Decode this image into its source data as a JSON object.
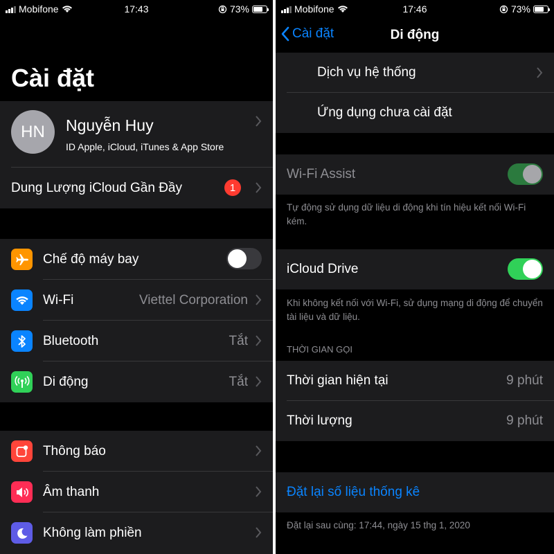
{
  "left": {
    "status": {
      "carrier": "Mobifone",
      "time": "17:43",
      "battery": "73%"
    },
    "title": "Cài đặt",
    "profile": {
      "initials": "HN",
      "name": "Nguyễn Huy",
      "subtitle": "ID Apple, iCloud, iTunes & App Store"
    },
    "icloud_row": {
      "label": "Dung Lượng iCloud Gần Đầy",
      "badge": "1"
    },
    "connectivity": {
      "airplane": {
        "label": "Chế độ máy bay",
        "icon": "airplane-icon",
        "color": "#ff9500",
        "on": false
      },
      "wifi": {
        "label": "Wi-Fi",
        "value": "Viettel Corporation",
        "icon": "wifi-icon",
        "color": "#0a84ff"
      },
      "bluetooth": {
        "label": "Bluetooth",
        "value": "Tắt",
        "icon": "bluetooth-icon",
        "color": "#0a84ff"
      },
      "cellular": {
        "label": "Di động",
        "value": "Tắt",
        "icon": "antenna-icon",
        "color": "#30d158"
      }
    },
    "notifications": {
      "notify": {
        "label": "Thông báo",
        "icon": "notification-icon",
        "color": "#ff453a"
      },
      "sounds": {
        "label": "Âm thanh",
        "icon": "speaker-icon",
        "color": "#ff2d55"
      },
      "dnd": {
        "label": "Không làm phiền",
        "icon": "moon-icon",
        "color": "#5e5ce6"
      }
    }
  },
  "right": {
    "status": {
      "carrier": "Mobifone",
      "time": "17:46",
      "battery": "73%"
    },
    "nav": {
      "back_label": "Cài đặt",
      "title": "Di động"
    },
    "apps": {
      "system_services": "Dịch vụ hệ thống",
      "uninstalled": "Ứng dụng chưa cài đặt"
    },
    "wifi_assist": {
      "label": "Wi-Fi Assist",
      "on": true,
      "footer": "Tự động sử dụng dữ liệu di động khi tín hiệu kết nối Wi-Fi kém."
    },
    "icloud_drive": {
      "label": "iCloud Drive",
      "on": true,
      "footer": "Khi không kết nối với Wi-Fi, sử dụng mạng di động để chuyển tài liệu và dữ liệu."
    },
    "call_time": {
      "header": "THỜI GIAN GỌI",
      "current_label": "Thời gian hiện tại",
      "current_value": "9 phút",
      "lifetime_label": "Thời lượng",
      "lifetime_value": "9 phút"
    },
    "reset": {
      "label": "Đặt lại số liệu thống kê",
      "footer": "Đặt lại sau cùng: 17:44, ngày 15 thg 1, 2020"
    }
  },
  "colors": {
    "accent": "#0a84ff",
    "toggle_on": "#30d158",
    "toggle_on_dim": "#2b7a3e",
    "toggle_off": "#39393d",
    "cell_bg": "#1c1c1e",
    "secondary_text": "#8e8e93"
  }
}
